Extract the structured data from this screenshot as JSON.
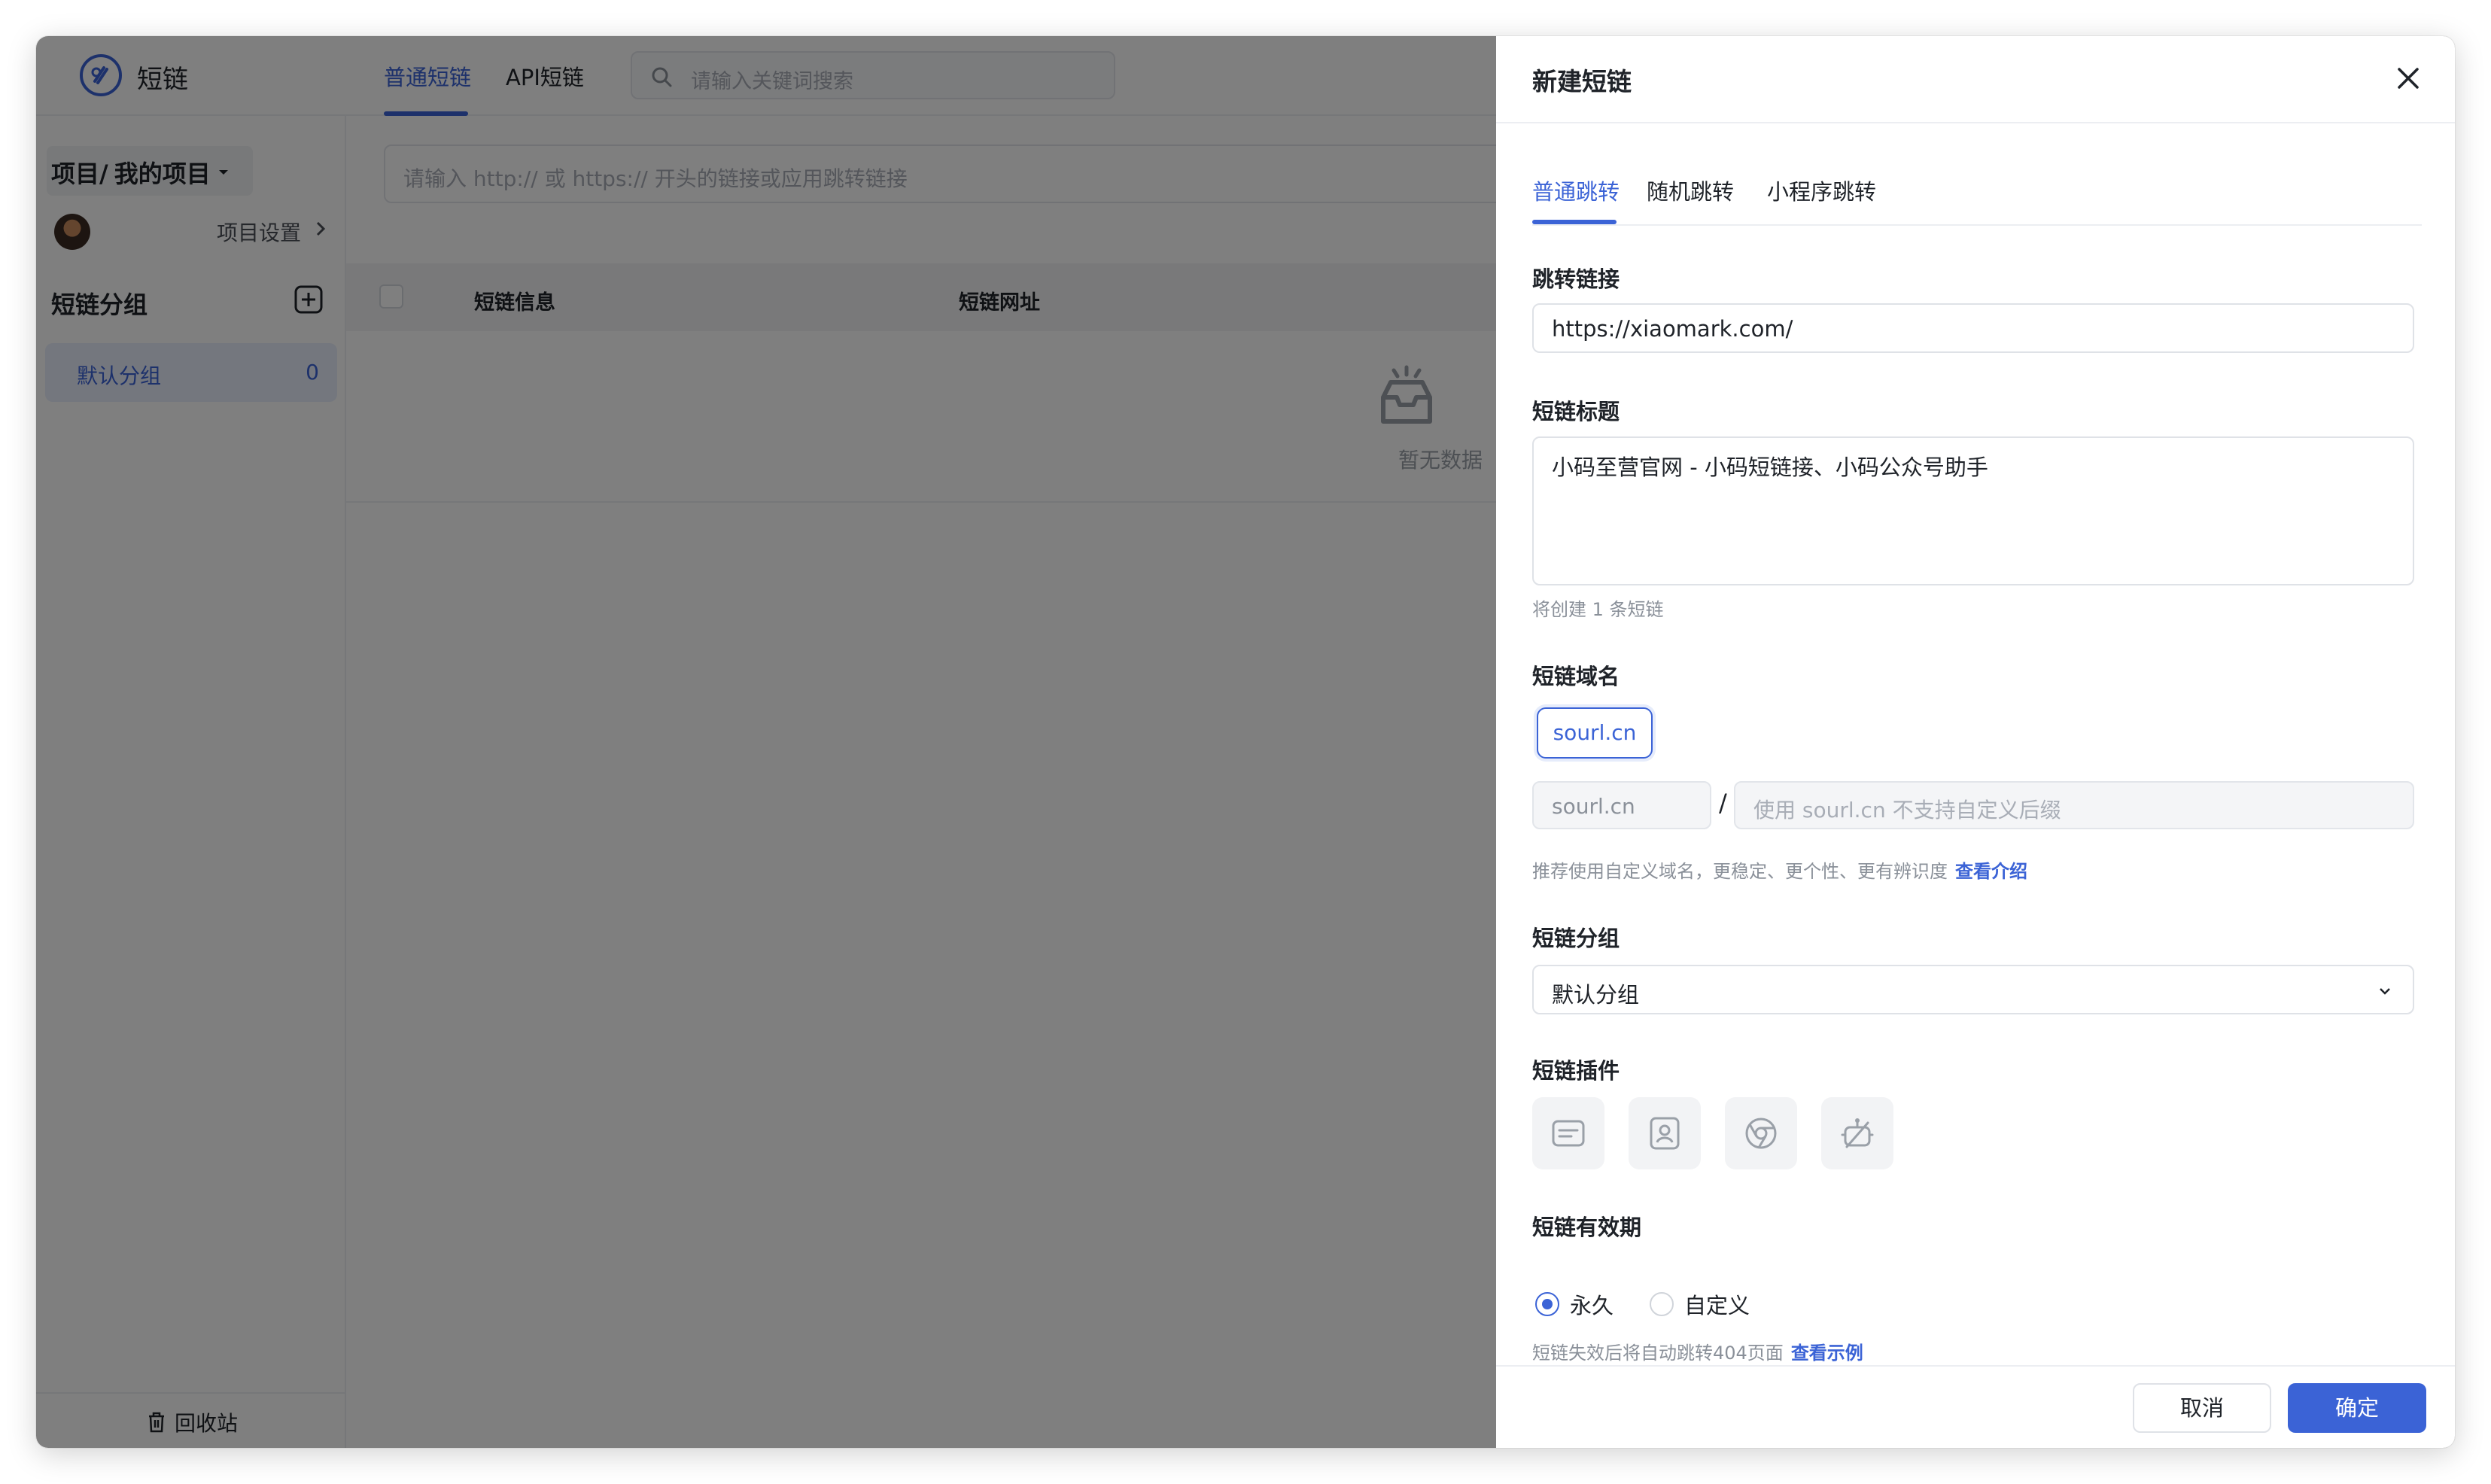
{
  "app": {
    "name": "短链",
    "nav_tabs": [
      {
        "label": "普通短链",
        "active": true
      },
      {
        "label": "API短链",
        "active": false
      }
    ],
    "search_placeholder": "请输入关键词搜索"
  },
  "sidebar": {
    "breadcrumb_prefix": "项目/",
    "breadcrumb_project": "我的项目",
    "project_settings_label": "项目设置",
    "group_title": "短链分组",
    "groups": [
      {
        "label": "默认分组",
        "count": "0"
      }
    ],
    "recycle_label": "回收站"
  },
  "main": {
    "url_placeholder": "请输入 http:// 或 https:// 开头的链接或应用跳转链接",
    "columns": [
      "短链信息",
      "短链网址"
    ],
    "empty_text": "暂无数据"
  },
  "drawer": {
    "title": "新建短链",
    "tabs": [
      {
        "label": "普通跳转",
        "active": true
      },
      {
        "label": "随机跳转",
        "active": false
      },
      {
        "label": "小程序跳转",
        "active": false
      }
    ],
    "redirect_link": {
      "label": "跳转链接",
      "value": "https://xiaomark.com/"
    },
    "short_title": {
      "label": "短链标题",
      "value": "小码至营官网 - 小码短链接、小码公众号助手",
      "hint": "将创建 1 条短链"
    },
    "domain": {
      "label": "短链域名",
      "chip": "sourl.cn",
      "prefix": "sourl.cn",
      "separator": "/",
      "suffix_placeholder": "使用 sourl.cn 不支持自定义后缀",
      "hint": "推荐使用自定义域名，更稳定、更个性、更有辨识度",
      "hint_link": "查看介绍"
    },
    "group": {
      "label": "短链分组",
      "selected": "默认分组"
    },
    "plugins": {
      "label": "短链插件",
      "icons": [
        "message-card-icon",
        "contact-card-icon",
        "browser-icon",
        "robot-icon"
      ]
    },
    "validity": {
      "label": "短链有效期",
      "options": [
        {
          "label": "永久",
          "checked": true
        },
        {
          "label": "自定义",
          "checked": false
        }
      ],
      "hint": "短链失效后将自动跳转404页面",
      "hint_link": "查看示例"
    },
    "cancel_label": "取消",
    "confirm_label": "确定"
  },
  "colors": {
    "accent": "#3b63d6",
    "overlay": "rgba(0,0,0,0.5)"
  }
}
